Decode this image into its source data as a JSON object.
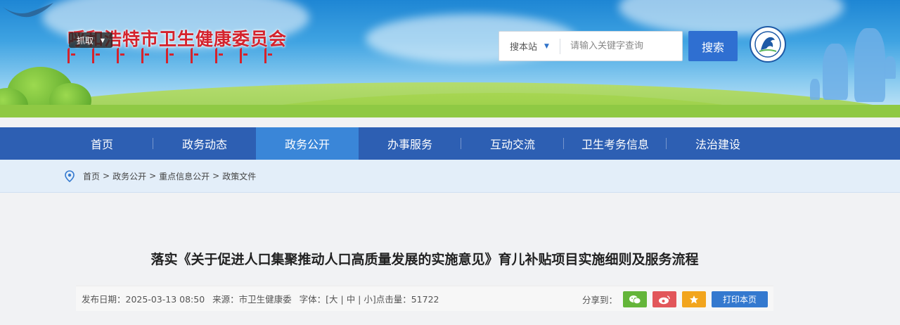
{
  "header": {
    "site_title": "呼和浩特市卫生健康委员会",
    "grab_label": "抓取",
    "search": {
      "scope_label": "搜本站",
      "placeholder": "请输入关键字查询",
      "value": "",
      "button_label": "搜索"
    }
  },
  "nav": {
    "items": [
      {
        "label": "首页"
      },
      {
        "label": "政务动态"
      },
      {
        "label": "政务公开"
      },
      {
        "label": "办事服务"
      },
      {
        "label": "互动交流"
      },
      {
        "label": "卫生考务信息"
      },
      {
        "label": "法治建设"
      }
    ],
    "active_label": "政务公开"
  },
  "breadcrumb": {
    "items": [
      "首页",
      "政务公开",
      "重点信息公开",
      "政策文件"
    ],
    "separator": ">"
  },
  "article": {
    "title": "落实《关于促进人口集聚推动人口高质量发展的实施意见》育儿补贴项目实施细则及服务流程",
    "publish_date": "发布日期：2025-03-13 08:50",
    "source": "来源：市卫生健康委",
    "font_size_label": "字体：[大 | 中 | 小]",
    "views": "点击量：51722",
    "share_label": "分享到：",
    "print_label": "打印本页"
  },
  "colors": {
    "nav_bg": "#2d5fb3",
    "nav_active": "#3a86d8",
    "title_red": "#d4232d",
    "search_button": "#2f6fd1",
    "wechat": "#64b53a",
    "weibo": "#e2565a",
    "favorite": "#f2a51e",
    "print": "#3479cf"
  },
  "icons": [
    "location-pin-icon",
    "chevron-down-icon",
    "wechat-icon",
    "weibo-icon",
    "star-icon",
    "emblem-icon"
  ]
}
